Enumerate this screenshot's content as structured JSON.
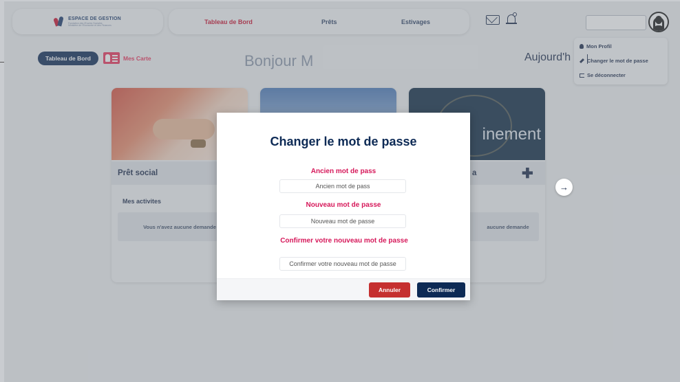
{
  "header": {
    "logo_title": "ESPACE DE GESTION",
    "logo_sub1": "Fondation des Œuvres Sociales",
    "logo_sub2": "Ministère de l'Economie et des Finances",
    "nav": [
      {
        "label": "Tableau de Bord",
        "active": true
      },
      {
        "label": "Prêts",
        "active": false
      },
      {
        "label": "Estivages",
        "active": false
      }
    ],
    "icons": [
      "mail-icon",
      "bell-icon",
      "avatar-icon"
    ]
  },
  "user_menu": {
    "items": [
      {
        "label": "Mon Profil",
        "icon": "user-icon"
      },
      {
        "label": "Changer le mot de passe",
        "icon": "key-icon"
      },
      {
        "label": "Se déconnecter",
        "icon": "logout-icon"
      }
    ]
  },
  "subheader": {
    "dashboard_button": "Tableau de Bord",
    "cards_link": "Mes Carte",
    "greeting": "Bonjour M",
    "today": "Aujourd'h"
  },
  "cards": [
    {
      "title": "Prêt social",
      "activities": "Mes activites",
      "empty": "Vous n'avez aucune demande"
    },
    {
      "title": "",
      "activities": "",
      "empty": ""
    },
    {
      "title": "a",
      "activities": "",
      "empty": "aucune demande",
      "image_text": "inement"
    }
  ],
  "modal": {
    "title": "Changer le mot de passe",
    "old_label": "Ancien mot de pass",
    "old_placeholder": "Ancien mot de pass",
    "new_label": "Nouveau mot de passe",
    "new_placeholder": "Nouveau mot de passe",
    "confirm_label": "Confirmer votre nouveau mot de passe",
    "confirm_placeholder": "Confirmer votre nouveau mot de passe",
    "cancel_button": "Annuler",
    "confirm_button": "Confirmer"
  },
  "colors": {
    "navy": "#0d2a55",
    "accent_red": "#c8102e",
    "pink": "#d6185a",
    "cancel_red": "#c53030"
  }
}
